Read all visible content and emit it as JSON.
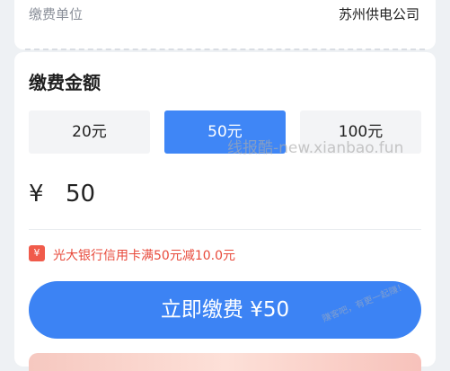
{
  "payee": {
    "label": "缴费单位",
    "value": "苏州供电公司"
  },
  "amount_section": {
    "title": "缴费金额",
    "options": [
      {
        "label": "20元"
      },
      {
        "label": "50元",
        "selected": true
      },
      {
        "label": "100元"
      }
    ],
    "currency_symbol": "¥",
    "input_value": "50"
  },
  "promo": {
    "icon_text": "¥",
    "text": "光大银行信用卡满50元减10.0元"
  },
  "pay_button": {
    "label": "立即缴费 ¥50"
  },
  "watermarks": {
    "main": "线报酷-new.xianbao.fun",
    "corner": "赚客吧，有更一起赚！"
  },
  "colors": {
    "accent_blue": "#3c83f4",
    "promo_red": "#e84a3b",
    "background": "#eef1f4"
  }
}
